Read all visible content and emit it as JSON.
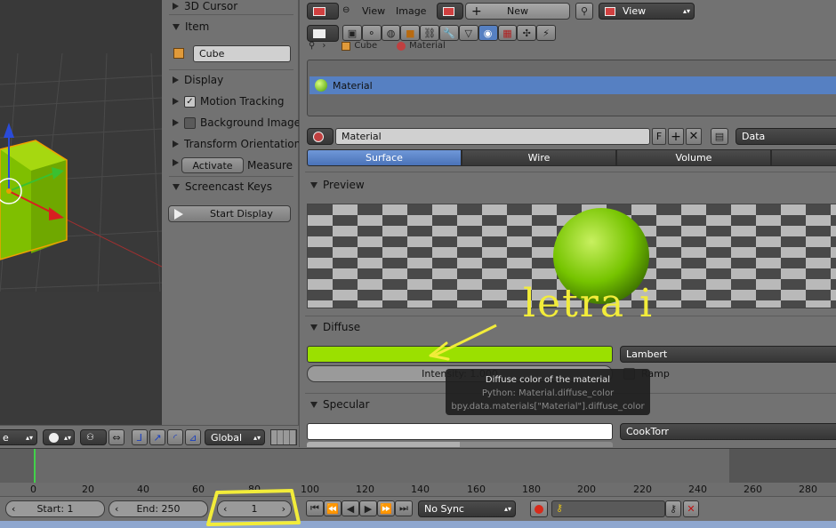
{
  "n_panel": {
    "cursor_header": "3D Cursor",
    "item_header": "Item",
    "item_name": "Cube",
    "display_header": "Display",
    "motion_tracking_label": "Motion Tracking",
    "background_images_label": "Background Images",
    "transform_orientations_label": "Transform Orientations",
    "activate_label": "Activate",
    "measure_label": "Measure",
    "screencast_header": "Screencast Keys",
    "start_display_label": "Start Display"
  },
  "viewport_header": {
    "mode_partial": "e",
    "orientation": "Global"
  },
  "image_header": {
    "view_menu": "View",
    "image_menu": "Image",
    "new_button": "New",
    "view_select": "View"
  },
  "properties": {
    "breadcrumb": [
      "Cube",
      "Material"
    ],
    "slot_name": "Material",
    "material_name": "Material",
    "fake_user": "F",
    "link_select": "Data",
    "tabs": [
      "Surface",
      "Wire",
      "Volume"
    ],
    "active_tab": "Surface",
    "preview_header": "Preview",
    "diffuse_header": "Diffuse",
    "diffuse_shader": "Lambert",
    "intensity_label": "Intensity: 1.000",
    "ramp_label": "Ramp",
    "specular_header": "Specular",
    "specular_shader": "CookTorr",
    "diffuse_color": "#9be000"
  },
  "tooltip": {
    "title": "Diffuse color of the material",
    "python": "Python: Material.diffuse_color",
    "path": "bpy.data.materials[\"Material\"].diffuse_color"
  },
  "annotation": {
    "text": "letra i",
    "color": "#f2ec3a"
  },
  "timeline": {
    "ticks": [
      "0",
      "20",
      "40",
      "60",
      "80",
      "100",
      "120",
      "140",
      "160",
      "180",
      "200",
      "220",
      "240",
      "260",
      "280"
    ],
    "start_label": "Start: 1",
    "end_label": "End: 250",
    "current_frame": "1",
    "sync_mode": "No Sync"
  }
}
